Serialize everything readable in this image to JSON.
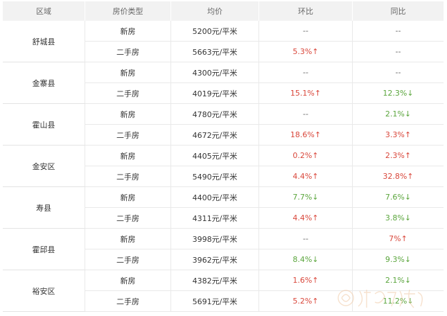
{
  "headers": [
    "区域",
    "房价类型",
    "均价",
    "环比",
    "同比"
  ],
  "rows": [
    {
      "district": "舒城县",
      "items": [
        {
          "type": "新房",
          "price": "5200元/平米",
          "mom": "--",
          "mom_dir": "na",
          "yoy": "--",
          "yoy_dir": "na"
        },
        {
          "type": "二手房",
          "price": "5663元/平米",
          "mom": "5.3%↑",
          "mom_dir": "up",
          "yoy": "--",
          "yoy_dir": "na"
        }
      ]
    },
    {
      "district": "金寨县",
      "items": [
        {
          "type": "新房",
          "price": "4300元/平米",
          "mom": "--",
          "mom_dir": "na",
          "yoy": "--",
          "yoy_dir": "na"
        },
        {
          "type": "二手房",
          "price": "4019元/平米",
          "mom": "15.1%↑",
          "mom_dir": "up",
          "yoy": "12.3%↓",
          "yoy_dir": "down"
        }
      ]
    },
    {
      "district": "霍山县",
      "items": [
        {
          "type": "新房",
          "price": "4780元/平米",
          "mom": "--",
          "mom_dir": "na",
          "yoy": "2.1%↓",
          "yoy_dir": "down"
        },
        {
          "type": "二手房",
          "price": "4672元/平米",
          "mom": "18.6%↑",
          "mom_dir": "up",
          "yoy": "3.3%↑",
          "yoy_dir": "up"
        }
      ]
    },
    {
      "district": "金安区",
      "items": [
        {
          "type": "新房",
          "price": "4405元/平米",
          "mom": "0.2%↑",
          "mom_dir": "up",
          "yoy": "2.3%↑",
          "yoy_dir": "up"
        },
        {
          "type": "二手房",
          "price": "5490元/平米",
          "mom": "4.4%↑",
          "mom_dir": "up",
          "yoy": "32.8%↑",
          "yoy_dir": "up"
        }
      ]
    },
    {
      "district": "寿县",
      "items": [
        {
          "type": "新房",
          "price": "4400元/平米",
          "mom": "7.7%↓",
          "mom_dir": "down",
          "yoy": "7.6%↓",
          "yoy_dir": "down"
        },
        {
          "type": "二手房",
          "price": "4311元/平米",
          "mom": "4.4%↑",
          "mom_dir": "up",
          "yoy": "3.8%↓",
          "yoy_dir": "down"
        }
      ]
    },
    {
      "district": "霍邱县",
      "items": [
        {
          "type": "新房",
          "price": "3998元/平米",
          "mom": "--",
          "mom_dir": "na",
          "yoy": "7%↑",
          "yoy_dir": "up"
        },
        {
          "type": "二手房",
          "price": "3962元/平米",
          "mom": "8.4%↓",
          "mom_dir": "down",
          "yoy": "9.3%↓",
          "yoy_dir": "down"
        }
      ]
    },
    {
      "district": "裕安区",
      "items": [
        {
          "type": "新房",
          "price": "4382元/平米",
          "mom": "1.6%↑",
          "mom_dir": "up",
          "yoy": "2.1%↓",
          "yoy_dir": "down"
        },
        {
          "type": "二手房",
          "price": "5691元/平米",
          "mom": "5.2%↑",
          "mom_dir": "up",
          "yoy": "11.2%↓",
          "yoy_dir": "down"
        }
      ]
    }
  ],
  "colors": {
    "up": "#d9463a",
    "down": "#5aa53c",
    "header_bg": "#f2f2f2"
  },
  "watermark_icon": "logo-watermark"
}
